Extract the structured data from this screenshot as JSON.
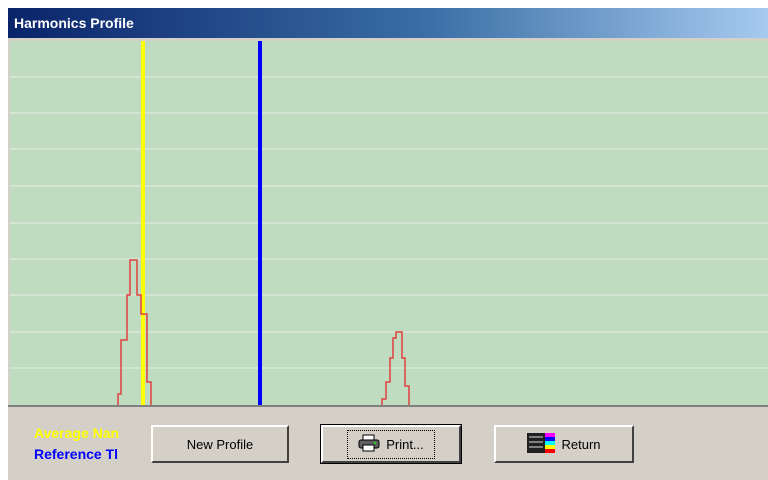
{
  "window": {
    "title": "Harmonics Profile"
  },
  "plot": {
    "background": "#c0dcc0",
    "grid_color": "#d8e8d8",
    "yellow_marker_color": "#ffff00",
    "blue_marker_color": "#0000ff",
    "profile_color": "#e04040"
  },
  "legend": {
    "average_label": "Average Nan",
    "average_color": "#ffff00",
    "reference_label": "Reference Tl",
    "reference_color": "#0000ff"
  },
  "buttons": {
    "new_profile": "New Profile",
    "print": "Print...",
    "return": "Return"
  },
  "icons": {
    "print": "printer-icon",
    "return": "color-palette-icon"
  }
}
